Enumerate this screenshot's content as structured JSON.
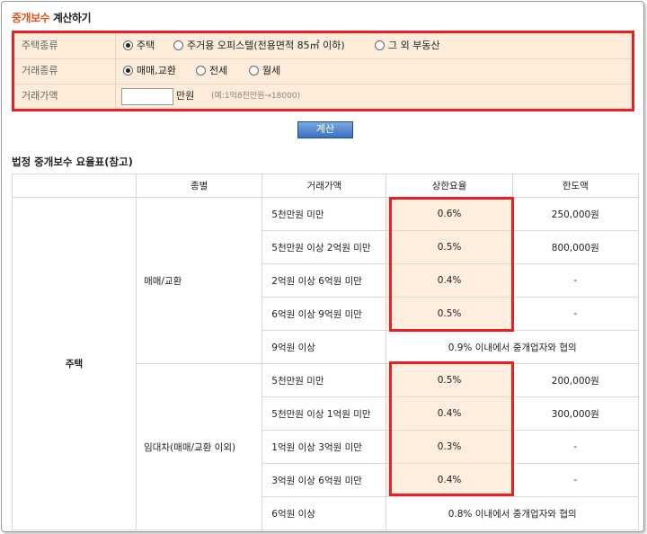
{
  "title": {
    "highlight": "중개보수",
    "rest": " 계산하기"
  },
  "form": {
    "rows": [
      {
        "label": "주택종류",
        "options": [
          "주택",
          "주거용 오피스텔(전용면적 85㎡ 이하)",
          "그 외 부동산"
        ],
        "selected": 0
      },
      {
        "label": "거래종류",
        "options": [
          "매매,교환",
          "전세",
          "월세"
        ],
        "selected": 0
      },
      {
        "label": "거래가액",
        "input_value": "",
        "unit": "만원",
        "hint": "(예:1억8천만원→18000)"
      }
    ],
    "calc_button": "계산"
  },
  "table": {
    "subtitle": "법정 중개보수 요율표(참고)",
    "headers": [
      "",
      "종별",
      "거래가액",
      "상한요율",
      "한도액"
    ],
    "category": "주택",
    "groups": [
      {
        "kind": "매매/교환",
        "rows": [
          {
            "price": "5천만원 미만",
            "rate": "0.6%",
            "limit": "250,000원"
          },
          {
            "price": "5천만원 이상 2억원 미만",
            "rate": "0.5%",
            "limit": "800,000원"
          },
          {
            "price": "2억원 이상 6억원 미만",
            "rate": "0.4%",
            "limit": "-"
          },
          {
            "price": "6억원 이상 9억원 미만",
            "rate": "0.5%",
            "limit": "-"
          }
        ],
        "tail": {
          "price": "9억원 이상",
          "note": "0.9% 이내에서 중개업자와 협의"
        }
      },
      {
        "kind": "임대차(매매/교환 이외)",
        "rows": [
          {
            "price": "5천만원 미만",
            "rate": "0.5%",
            "limit": "200,000원"
          },
          {
            "price": "5천만원 이상 1억원 미만",
            "rate": "0.4%",
            "limit": "300,000원"
          },
          {
            "price": "1억원 이상 3억원 미만",
            "rate": "0.3%",
            "limit": "-"
          },
          {
            "price": "3억원 이상 6억원 미만",
            "rate": "0.4%",
            "limit": "-"
          }
        ],
        "tail": {
          "price": "6억원 이상",
          "note": "0.8% 이내에서 중개업자와 협의"
        }
      }
    ]
  },
  "colors": {
    "accent": "#e0541c",
    "highlight_border": "#ee1d24",
    "form_bg": "#fcecd9",
    "rate_bg": "#fdeedd"
  }
}
